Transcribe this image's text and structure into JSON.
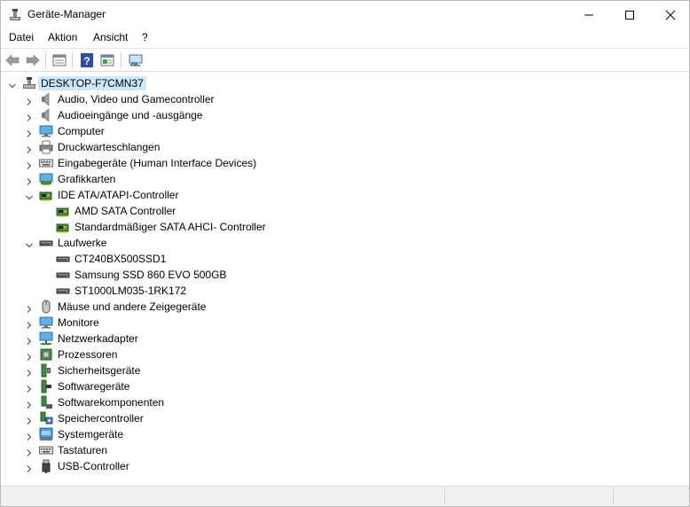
{
  "window": {
    "title": "Geräte-Manager",
    "icons": {
      "app": "device-manager-icon",
      "minimize": "minimize-icon",
      "maximize": "maximize-icon",
      "close": "close-icon"
    }
  },
  "menu": {
    "items": [
      {
        "label": "Datei"
      },
      {
        "label": "Aktion"
      },
      {
        "label": "Ansicht"
      },
      {
        "label": "?"
      }
    ]
  },
  "toolbar": {
    "buttons": [
      {
        "icon": "back-arrow-icon"
      },
      {
        "icon": "forward-arrow-icon"
      },
      {
        "icon": "properties-icon"
      },
      {
        "icon": "help-icon"
      },
      {
        "icon": "view-panel-icon"
      },
      {
        "icon": "scan-hardware-icon"
      }
    ]
  },
  "tree": {
    "root": {
      "label": "DESKTOP-F7CMN37",
      "icon": "computer-tree-icon",
      "expanded": true,
      "selected": true
    },
    "categories": [
      {
        "label": "Audio, Video und Gamecontroller",
        "icon": "speaker-icon",
        "expanded": false
      },
      {
        "label": "Audioeingänge und -ausgänge",
        "icon": "speaker-icon",
        "expanded": false
      },
      {
        "label": "Computer",
        "icon": "monitor-icon",
        "expanded": false
      },
      {
        "label": "Druckwarteschlangen",
        "icon": "printer-icon",
        "expanded": false
      },
      {
        "label": "Eingabegeräte (Human Interface Devices)",
        "icon": "keyboard-icon",
        "expanded": false
      },
      {
        "label": "Grafikkarten",
        "icon": "display-adapter-icon",
        "expanded": false
      },
      {
        "label": "IDE ATA/ATAPI-Controller",
        "icon": "ide-controller-icon",
        "expanded": true,
        "children": [
          {
            "label": "AMD SATA Controller",
            "icon": "ide-controller-icon"
          },
          {
            "label": "Standardmäßiger SATA AHCI- Controller",
            "icon": "ide-controller-icon"
          }
        ]
      },
      {
        "label": "Laufwerke",
        "icon": "disk-drive-icon",
        "expanded": true,
        "children": [
          {
            "label": "CT240BX500SSD1",
            "icon": "disk-drive-icon"
          },
          {
            "label": "Samsung SSD 860 EVO 500GB",
            "icon": "disk-drive-icon"
          },
          {
            "label": "ST1000LM035-1RK172",
            "icon": "disk-drive-icon"
          }
        ]
      },
      {
        "label": "Mäuse und andere Zeigegeräte",
        "icon": "mouse-icon",
        "expanded": false
      },
      {
        "label": "Monitore",
        "icon": "monitor-icon",
        "expanded": false
      },
      {
        "label": "Netzwerkadapter",
        "icon": "network-adapter-icon",
        "expanded": false
      },
      {
        "label": "Prozessoren",
        "icon": "processor-icon",
        "expanded": false
      },
      {
        "label": "Sicherheitsgeräte",
        "icon": "security-device-icon",
        "expanded": false
      },
      {
        "label": "Softwaregeräte",
        "icon": "software-device-icon",
        "expanded": false
      },
      {
        "label": "Softwarekomponenten",
        "icon": "software-component-icon",
        "expanded": false
      },
      {
        "label": "Speichercontroller",
        "icon": "storage-controller-icon",
        "expanded": false
      },
      {
        "label": "Systemgeräte",
        "icon": "system-device-icon",
        "expanded": false
      },
      {
        "label": "Tastaturen",
        "icon": "keyboard-icon",
        "expanded": false
      },
      {
        "label": "USB-Controller",
        "icon": "usb-icon",
        "expanded": false
      }
    ]
  },
  "colors": {
    "selection": "#cce8ff",
    "accent": "#0078d7"
  }
}
